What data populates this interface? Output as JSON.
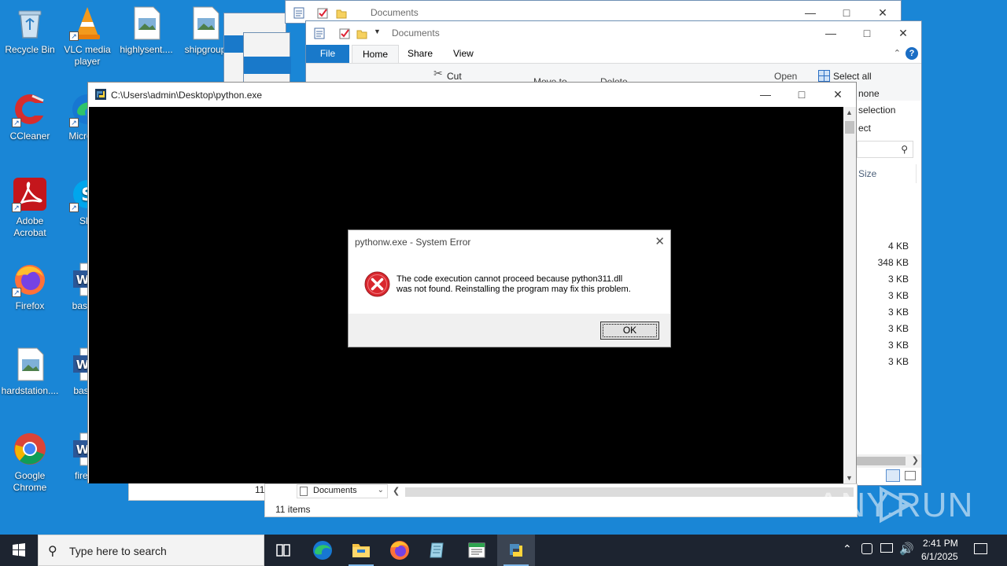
{
  "desktop_icons": [
    {
      "label": "Recycle Bin",
      "icon": "recycle-bin-icon"
    },
    {
      "label": "VLC media player",
      "icon": "vlc-icon"
    },
    {
      "label": "highlysent....",
      "icon": "image-file-icon"
    },
    {
      "label": "shipgroup",
      "icon": "image-file-icon"
    },
    {
      "label": "CCleaner",
      "icon": "ccleaner-icon"
    },
    {
      "label": "Micro Ed",
      "icon": "edge-icon"
    },
    {
      "label": "Adobe Acrobat",
      "icon": "acrobat-icon"
    },
    {
      "label": "Sky",
      "icon": "skype-icon"
    },
    {
      "label": "Firefox",
      "icon": "firefox-icon"
    },
    {
      "label": "basech",
      "icon": "word-doc-icon"
    },
    {
      "label": "hardstation....",
      "icon": "image-file-icon"
    },
    {
      "label": "basictr",
      "icon": "word-doc-icon"
    },
    {
      "label": "Google Chrome",
      "icon": "chrome-icon"
    },
    {
      "label": "firewri",
      "icon": "word-doc-icon"
    }
  ],
  "explorer_back": {
    "title": "Documents",
    "status_count": "11"
  },
  "explorer_front": {
    "title": "Documents",
    "tabs": [
      "File",
      "Home",
      "Share",
      "View"
    ],
    "ribbon": {
      "cut": "Cut",
      "move_to": "Move to",
      "delete": "Delete",
      "open": "Open",
      "select_all": "Select all",
      "select_none": "none",
      "invert_selection": "selection",
      "select_group": "ect"
    },
    "column_size": "Size",
    "sizes": [
      "4 KB",
      "348 KB",
      "3 KB",
      "3 KB",
      "3 KB",
      "3 KB",
      "3 KB",
      "3 KB"
    ],
    "address": "Documents",
    "status": "11 items"
  },
  "console": {
    "title": "C:\\Users\\admin\\Desktop\\python.exe"
  },
  "dialog": {
    "title": "pythonw.exe - System Error",
    "message_line1": "The code execution cannot proceed because python311.dll",
    "message_line2": "was not found. Reinstalling the program may fix this problem.",
    "ok": "OK"
  },
  "taskbar": {
    "search_placeholder": "Type here to search",
    "time": "2:41 PM",
    "date": "6/1/2025",
    "pins": [
      "task-view-icon",
      "edge-icon",
      "file-explorer-icon",
      "firefox-icon",
      "notepad-icon",
      "word-icon",
      "python-icon"
    ]
  },
  "watermark": "ANY.RUN",
  "colors": {
    "desktop": "#1a86d6",
    "taskbar": "#1d2430",
    "error_red": "#d9272e",
    "ribbon_file": "#1979ca"
  }
}
